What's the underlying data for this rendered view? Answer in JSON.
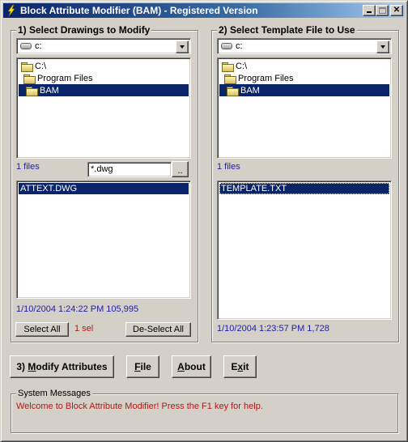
{
  "window": {
    "title": "Block Attribute Modifier (BAM) - Registered Version",
    "controls": {
      "minimize": "minimize",
      "maximize": "maximize",
      "close": "✕"
    }
  },
  "drawings": {
    "group_label": "1) Select Drawings to Modify",
    "drive": "c:",
    "folders": [
      {
        "name": "C:\\",
        "selected": false
      },
      {
        "name": "Program Files",
        "selected": false
      },
      {
        "name": "BAM",
        "selected": true
      }
    ],
    "file_count": "1 files",
    "filter": "*.dwg",
    "browse_label": "..",
    "files": [
      {
        "name": "ATTEXT.DWG",
        "selected": true
      }
    ],
    "file_info": "1/10/2004 1:24:22 PM  105,995",
    "select_all_label": "Select All",
    "selection_count": "1 sel",
    "deselect_all_label": "De-Select All"
  },
  "template": {
    "group_label": "2) Select Template File to Use",
    "drive": "c:",
    "folders": [
      {
        "name": "C:\\",
        "selected": false
      },
      {
        "name": "Program Files",
        "selected": false
      },
      {
        "name": "BAM",
        "selected": true
      }
    ],
    "file_count": "1 files",
    "files": [
      {
        "name": "TEMPLATE.TXT",
        "selected": true
      }
    ],
    "file_info": "1/10/2004 1:23:57 PM  1,728"
  },
  "actions": {
    "modify": {
      "prefix": "3) ",
      "mnemonic": "M",
      "rest": "odify Attributes"
    },
    "file": {
      "prefix": "",
      "mnemonic": "F",
      "rest": "ile"
    },
    "about": {
      "prefix": "",
      "mnemonic": "A",
      "rest": "bout"
    },
    "exit": {
      "prefix": "E",
      "mnemonic": "x",
      "rest": "it"
    }
  },
  "messages": {
    "group_label": "System Messages",
    "text": "Welcome to Block Attribute Modifier! Press the F1 key for help."
  },
  "colors": {
    "selection": "#0a246a",
    "info_text": "#1d1da8",
    "alert_text": "#b01818",
    "face": "#d4d0c8"
  }
}
